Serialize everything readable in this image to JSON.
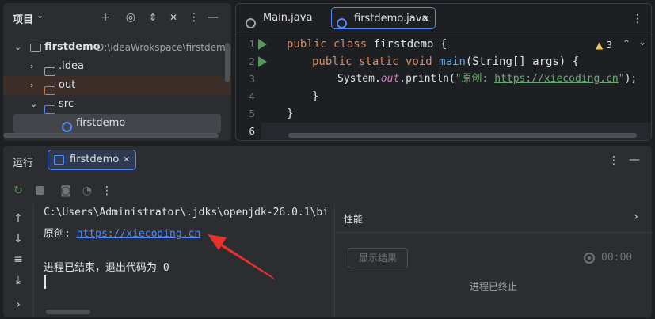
{
  "project_panel": {
    "title": "项目",
    "tree": {
      "root_name": "firstdemo",
      "root_path": "D:\\ideaWrokspace\\firstdemo",
      "idea": ".idea",
      "out": "out",
      "src": "src",
      "class_file": "firstdemo"
    }
  },
  "editor": {
    "tabs": [
      {
        "label": "Main.java"
      },
      {
        "label": "firstdemo.java"
      }
    ],
    "warnings_count": "3",
    "line_numbers": [
      "1",
      "2",
      "3",
      "4",
      "5",
      "6"
    ],
    "code": {
      "l1_kw": "public class ",
      "l1_name": "firstdemo {",
      "l2_kw": "public static void ",
      "l2_fn": "main",
      "l2_rest": "(String[] args) {",
      "l3_a": "System.",
      "l3_out": "out",
      "l3_b": ".println(",
      "l3_str_prefix": "\"原创: ",
      "l3_link": "https://xiecoding.cn",
      "l3_str_suffix": "\"",
      "l3_end": ");",
      "l4": "}",
      "l5": "}"
    }
  },
  "run_panel": {
    "title": "运行",
    "tab_label": "firstdemo",
    "console": {
      "line1": "C:\\Users\\Administrator\\.jdks\\openjdk-26.0.1\\bi",
      "line2_prefix": "原创: ",
      "line2_link": "https://xiecoding.cn",
      "line4": "进程已结束，退出代码为 0"
    },
    "perf": {
      "title": "性能",
      "show_results": "显示结果",
      "timer": "00:00",
      "status": "进程已终止"
    }
  },
  "colors": {
    "background": "#1e1f22",
    "panel": "#2b2d30",
    "accent": "#548af7",
    "green": "#57965c",
    "arrow_red": "#e5322d"
  }
}
